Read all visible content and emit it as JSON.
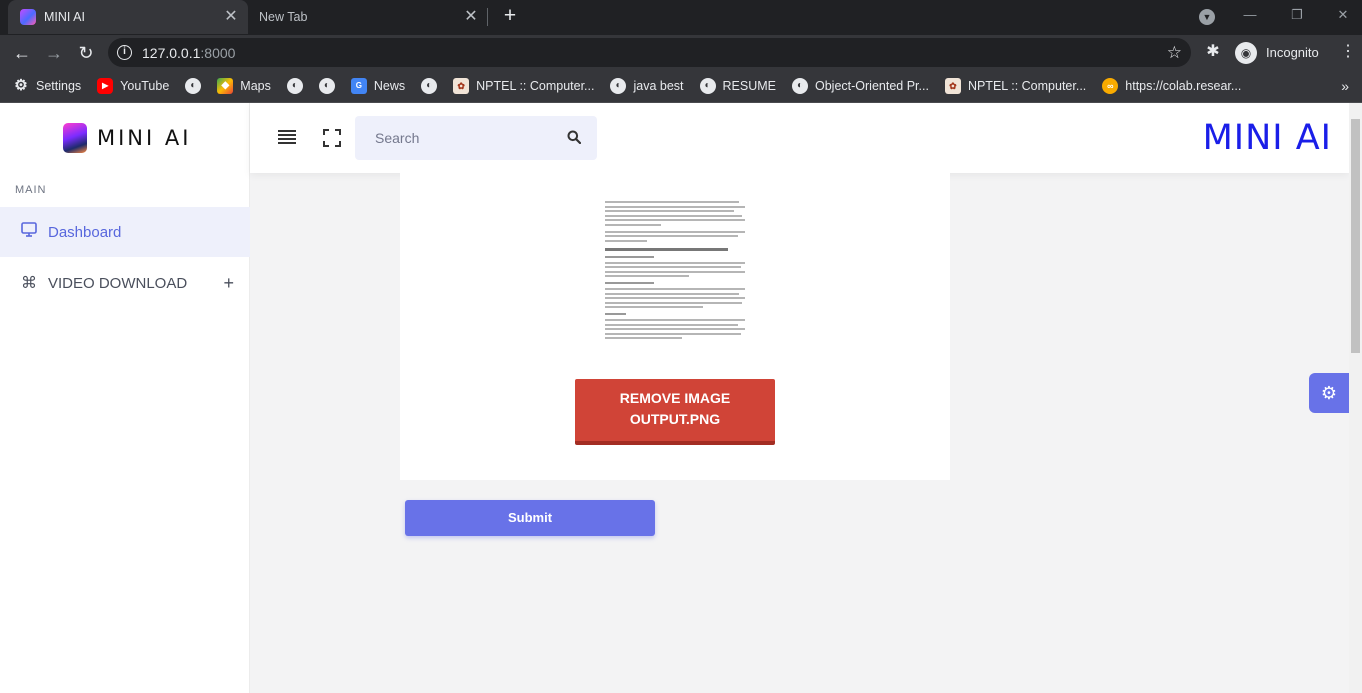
{
  "browser": {
    "tabs": [
      {
        "title": "MINI AI",
        "icon": "mini-ai-favicon"
      },
      {
        "title": "New Tab",
        "icon": ""
      }
    ],
    "address": {
      "host": "127.0.0.1",
      "port": ":8000"
    },
    "profile_label": "Incognito",
    "bookmarks": [
      {
        "label": "Settings",
        "icon": "gear-icon"
      },
      {
        "label": "YouTube",
        "icon": "youtube-icon"
      },
      {
        "label": "",
        "icon": "globe-icon"
      },
      {
        "label": "Maps",
        "icon": "maps-icon"
      },
      {
        "label": "",
        "icon": "globe-icon"
      },
      {
        "label": "",
        "icon": "globe-icon"
      },
      {
        "label": "News",
        "icon": "news-icon"
      },
      {
        "label": "",
        "icon": "globe-icon"
      },
      {
        "label": "NPTEL :: Computer...",
        "icon": "nptel-icon"
      },
      {
        "label": "java best",
        "icon": "globe-icon"
      },
      {
        "label": "RESUME",
        "icon": "globe-icon"
      },
      {
        "label": "Object-Oriented Pr...",
        "icon": "globe-icon"
      },
      {
        "label": "NPTEL :: Computer...",
        "icon": "nptel-icon"
      },
      {
        "label": "https://colab.resear...",
        "icon": "colab-icon"
      }
    ]
  },
  "sidebar": {
    "logo_text": "MINI AI",
    "section": "MAIN",
    "items": [
      {
        "label": "Dashboard",
        "icon": "monitor-icon",
        "active": true
      },
      {
        "label": "VIDEO DOWNLOAD",
        "icon": "command-icon",
        "expand": "+"
      }
    ]
  },
  "topbar": {
    "search_placeholder": "Search",
    "brand": "MINI AI"
  },
  "main": {
    "remove_button": {
      "line1": "REMOVE IMAGE",
      "line2": "OUTPUT.PNG"
    },
    "submit_label": "Submit"
  },
  "colors": {
    "accent": "#6872e8",
    "brand": "#1a1ee8",
    "danger": "#d04437",
    "sidebar_active_bg": "#eef0fb"
  }
}
